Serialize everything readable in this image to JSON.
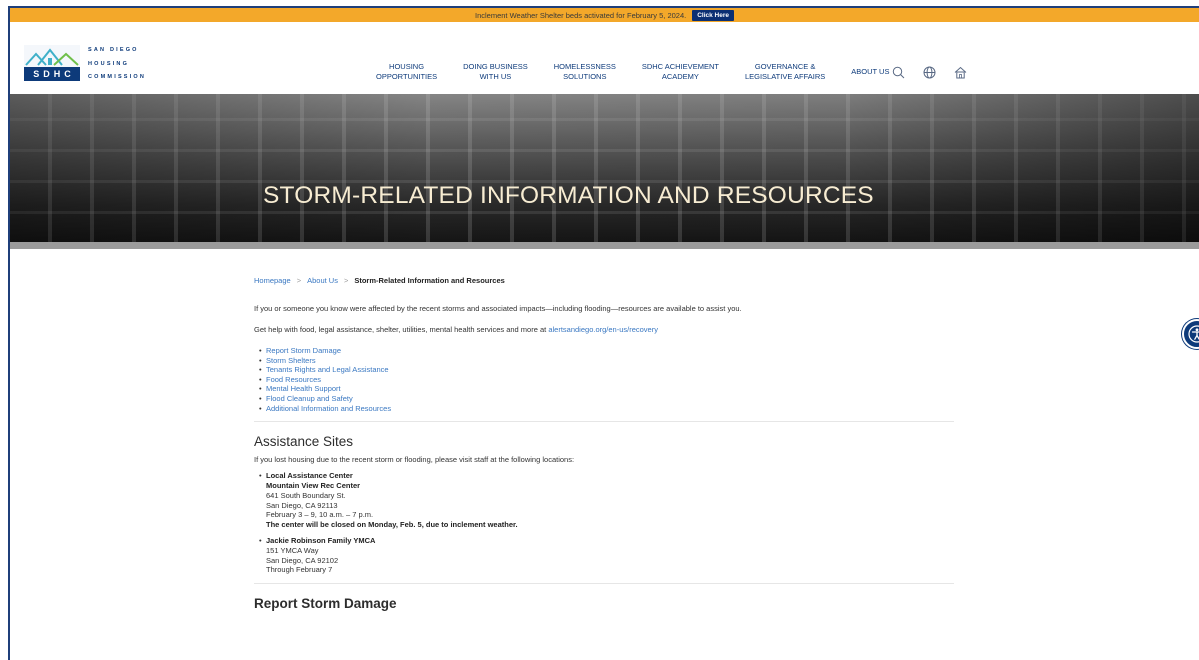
{
  "alert": {
    "text": "Inclement Weather Shelter beds activated for February 5, 2024.",
    "button_label": "Click Here"
  },
  "logo": {
    "line1": "SAN DIEGO",
    "line2": "HOUSING",
    "line3": "COMMISSION",
    "mark_text": "SDHC"
  },
  "nav": {
    "items": [
      {
        "line1": "HOUSING",
        "line2": "OPPORTUNITIES"
      },
      {
        "line1": "DOING BUSINESS",
        "line2": "WITH US"
      },
      {
        "line1": "HOMELESSNESS",
        "line2": "SOLUTIONS"
      },
      {
        "line1": "SDHC ACHIEVEMENT",
        "line2": "ACADEMY"
      },
      {
        "line1": "GOVERNANCE &",
        "line2": "LEGISLATIVE AFFAIRS"
      },
      {
        "line1": "ABOUT US",
        "line2": ""
      }
    ],
    "icons": [
      "search-icon",
      "globe-icon",
      "home-icon"
    ]
  },
  "hero": {
    "title": "STORM-RELATED INFORMATION AND RESOURCES"
  },
  "breadcrumb": {
    "home": "Homepage",
    "about": "About Us",
    "current": "Storm-Related Information and Resources",
    "separator": ">"
  },
  "intro": {
    "p1": "If you or someone you know were affected by the recent storms and associated impacts—including flooding—resources are available to assist you.",
    "p2_prefix": "Get help with food, legal assistance, shelter, utilities, mental health services and more at ",
    "p2_link": "alertsandiego.org/en-us/recovery"
  },
  "quick_links": [
    "Report Storm Damage",
    "Storm Shelters",
    "Tenants Rights and Legal Assistance",
    "Food Resources",
    "Mental Health Support",
    "Flood Cleanup and Safety",
    "Additional Information and Resources"
  ],
  "assistance": {
    "heading": "Assistance Sites",
    "intro": "If you lost housing due to the recent storm or flooding, please visit staff at the following locations:",
    "site1": {
      "name": "Local Assistance Center",
      "venue": "Mountain View Rec Center",
      "street": "641 South Boundary St.",
      "city": "San Diego, CA 92113",
      "hours": "February 3 – 9, 10 a.m. – 7 p.m.",
      "notice": "The center will be closed on Monday, Feb. 5, due to inclement weather."
    },
    "site2": {
      "name": "Jackie Robinson Family YMCA",
      "street": "151 YMCA Way",
      "city": "San Diego, CA 92102",
      "hours": "Through February 7"
    }
  },
  "next_section": {
    "heading": "Report Storm Damage"
  },
  "accessibility": {
    "icon": "accessibility-icon"
  }
}
